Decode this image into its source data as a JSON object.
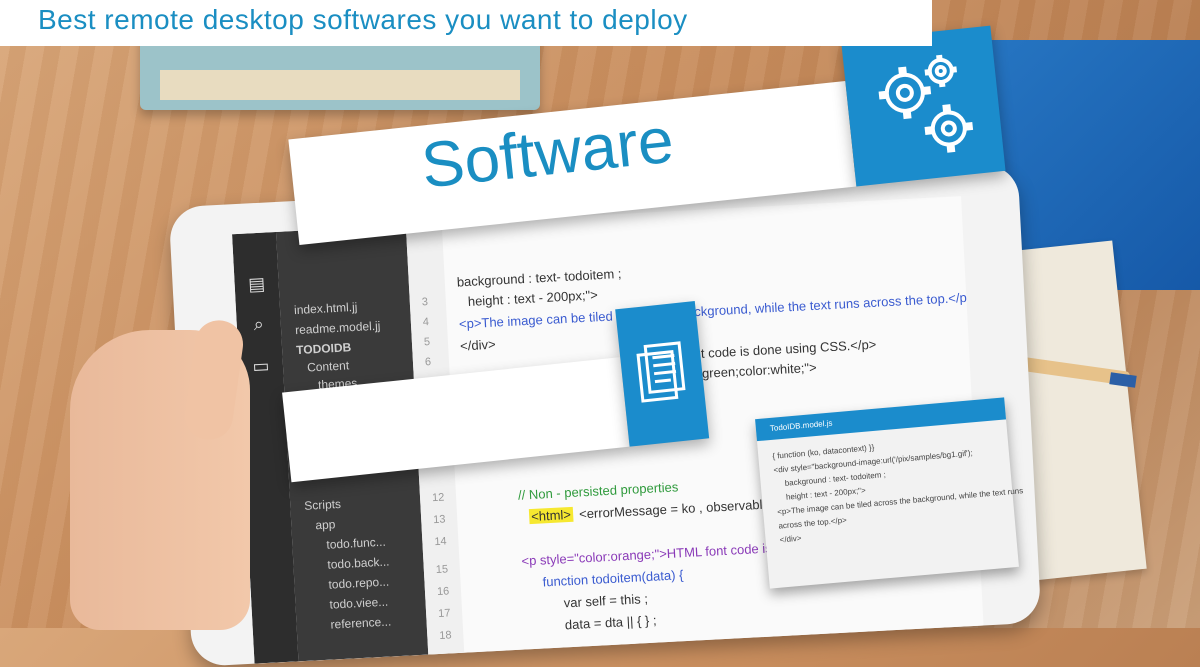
{
  "header": {
    "title": "Best remote desktop softwares you want to deploy"
  },
  "banner": {
    "title": "Software"
  },
  "icons": {
    "gears": "gears-icon",
    "document": "document-icon"
  },
  "colors": {
    "accent": "#1b8ccc",
    "title_text": "#1a8ec2"
  },
  "editor": {
    "files": [
      "index.html.jj",
      "readme.model.jj",
      "TODOIDB",
      "Content",
      "themes",
      "Scripts",
      "app",
      "todo.func...",
      "todo.back...",
      "todo.repo...",
      "todo.viee...",
      "reference..."
    ],
    "line_numbers": [
      "3",
      "4",
      "5",
      "6",
      "12",
      "13",
      "14",
      "15",
      "16",
      "17",
      "18"
    ],
    "code_lines": [
      "background : text- todoitem ;",
      "height : text - 200px;\">",
      "<p>The image can be tiled across the background, while the text runs across the top.</p>",
      "</div>",
      "t code is done using CSS.</p>",
      "green;color:white;\">",
      "// Non - persisted properties",
      "<html> <errorMessage = ko , observable() ;",
      "<p style=\"color:orange;\">HTML font code is done using CS",
      "function  todoitem(data) {",
      "var  self = this ;",
      "data = dta || { } ;"
    ]
  },
  "popup": {
    "title": "TodoIDB.model.js",
    "lines": [
      "{ function (ko, datacontext) }}",
      "<div style=\"background-image:url('/pix/samples/bg1.gif');",
      "background : text- todoitem ;",
      "height : text - 200px;\">",
      "<p>The image can be tiled across the background, while the text runs",
      "across the top.</p>",
      "</div>"
    ]
  }
}
